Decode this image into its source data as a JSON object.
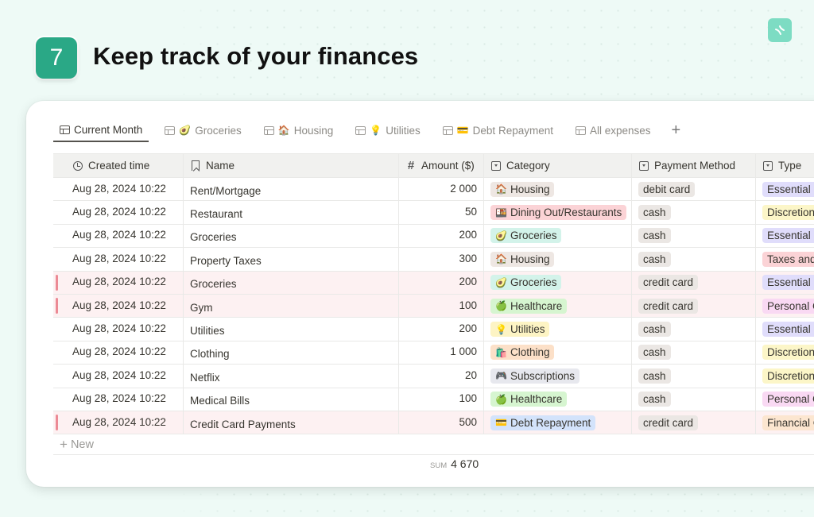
{
  "header": {
    "step_number": "7",
    "title": "Keep track of your finances",
    "corner_icon": "notion-logo-icon"
  },
  "tabs": [
    {
      "label": "Current Month",
      "emoji": "",
      "active": true
    },
    {
      "label": "Groceries",
      "emoji": "🥑",
      "active": false
    },
    {
      "label": "Housing",
      "emoji": "🏠",
      "active": false
    },
    {
      "label": "Utilities",
      "emoji": "💡",
      "active": false
    },
    {
      "label": "Debt Repayment",
      "emoji": "💳",
      "active": false
    },
    {
      "label": "All expenses",
      "emoji": "",
      "active": false
    }
  ],
  "add_tab_label": "+",
  "columns": {
    "created_time": "Created time",
    "name": "Name",
    "amount": "Amount ($)",
    "category": "Category",
    "payment_method": "Payment Method",
    "type": "Type"
  },
  "category_colors": {
    "Housing": "#eee7e3",
    "Dining Out/Restaurants": "#fbd3d6",
    "Groceries": "#d3f3ea",
    "Healthcare": "#d6f5d0",
    "Utilities": "#fdf4c4",
    "Clothing": "#fce0c8",
    "Subscriptions": "#e7e8ee",
    "Debt Repayment": "#d3e3fb"
  },
  "category_emojis": {
    "Housing": "🏠",
    "Dining Out/Restaurants": "🍱",
    "Groceries": "🥑",
    "Healthcare": "🍏",
    "Utilities": "💡",
    "Clothing": "🛍️",
    "Subscriptions": "🎮",
    "Debt Repayment": "💳"
  },
  "payment_color": "#ebe7e4",
  "type_colors": {
    "Essential E": "#e0ddfb",
    "Discretion": "#fcf6c8",
    "Taxes and": "#fbd3d6",
    "Personal C": "#f9d9f3",
    "Financial C": "#fce6d0"
  },
  "rows": [
    {
      "created": "Aug 28, 2024 10:22",
      "name": "Rent/Mortgage",
      "amount": "2 000",
      "category": "Housing",
      "payment": "debit card",
      "type": "Essential E",
      "highlight": false
    },
    {
      "created": "Aug 28, 2024 10:22",
      "name": "Restaurant",
      "amount": "50",
      "category": "Dining Out/Restaurants",
      "payment": "cash",
      "type": "Discretion",
      "highlight": false
    },
    {
      "created": "Aug 28, 2024 10:22",
      "name": "Groceries",
      "amount": "200",
      "category": "Groceries",
      "payment": "cash",
      "type": "Essential E",
      "highlight": false
    },
    {
      "created": "Aug 28, 2024 10:22",
      "name": "Property Taxes",
      "amount": "300",
      "category": "Housing",
      "payment": "cash",
      "type": "Taxes and",
      "highlight": false
    },
    {
      "created": "Aug 28, 2024 10:22",
      "name": "Groceries",
      "amount": "200",
      "category": "Groceries",
      "payment": "credit card",
      "type": "Essential E",
      "highlight": true
    },
    {
      "created": "Aug 28, 2024 10:22",
      "name": "Gym",
      "amount": "100",
      "category": "Healthcare",
      "payment": "credit card",
      "type": "Personal C",
      "highlight": true
    },
    {
      "created": "Aug 28, 2024 10:22",
      "name": "Utilities",
      "amount": "200",
      "category": "Utilities",
      "payment": "cash",
      "type": "Essential E",
      "highlight": false
    },
    {
      "created": "Aug 28, 2024 10:22",
      "name": "Clothing",
      "amount": "1 000",
      "category": "Clothing",
      "payment": "cash",
      "type": "Discretion",
      "highlight": false
    },
    {
      "created": "Aug 28, 2024 10:22",
      "name": "Netflix",
      "amount": "20",
      "category": "Subscriptions",
      "payment": "cash",
      "type": "Discretion",
      "highlight": false
    },
    {
      "created": "Aug 28, 2024 10:22",
      "name": "Medical Bills",
      "amount": "100",
      "category": "Healthcare",
      "payment": "cash",
      "type": "Personal C",
      "highlight": false
    },
    {
      "created": "Aug 28, 2024 10:22",
      "name": "Credit Card Payments",
      "amount": "500",
      "category": "Debt Repayment",
      "payment": "credit card",
      "type": "Financial C",
      "highlight": true
    }
  ],
  "new_row_label": "New",
  "footer": {
    "sum_label": "SUM",
    "sum_value": "4 670"
  }
}
